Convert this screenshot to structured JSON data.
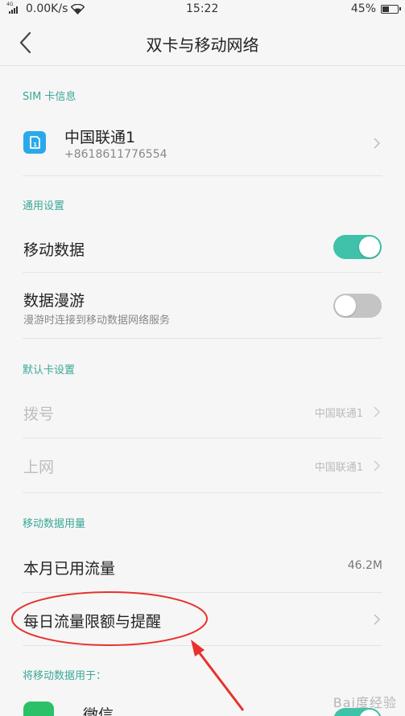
{
  "status_bar": {
    "network_tag": "4G",
    "speed": "0.00K/s",
    "time": "15:22",
    "battery": "45%",
    "battery_level": 0.45
  },
  "header": {
    "title": "双卡与移动网络"
  },
  "sim_section": {
    "label": "SIM 卡信息",
    "carrier": "中国联通1",
    "number": "+8618611776554"
  },
  "general_section": {
    "label": "通用设置",
    "mobile_data": {
      "label": "移动数据",
      "enabled": true
    },
    "roaming": {
      "label": "数据漫游",
      "desc": "漫游时连接到移动数据网络服务",
      "enabled": false
    }
  },
  "default_section": {
    "label": "默认卡设置",
    "dial": {
      "label": "拨号",
      "value": "中国联通1"
    },
    "internet": {
      "label": "上网",
      "value": "中国联通1"
    }
  },
  "usage_section": {
    "label": "移动数据用量",
    "month_used": {
      "label": "本月已用流量",
      "value": "46.2M"
    },
    "daily_limit": {
      "label": "每日流量限额与提醒"
    }
  },
  "apps_section": {
    "label": "将移动数据用于：",
    "first_app": "微信"
  },
  "watermark": "Bai度经验",
  "colors": {
    "accent": "#3aa898",
    "toggle_on": "#3fc2a9",
    "toggle_off": "#c4c4c4",
    "annotation": "#e8312d"
  }
}
